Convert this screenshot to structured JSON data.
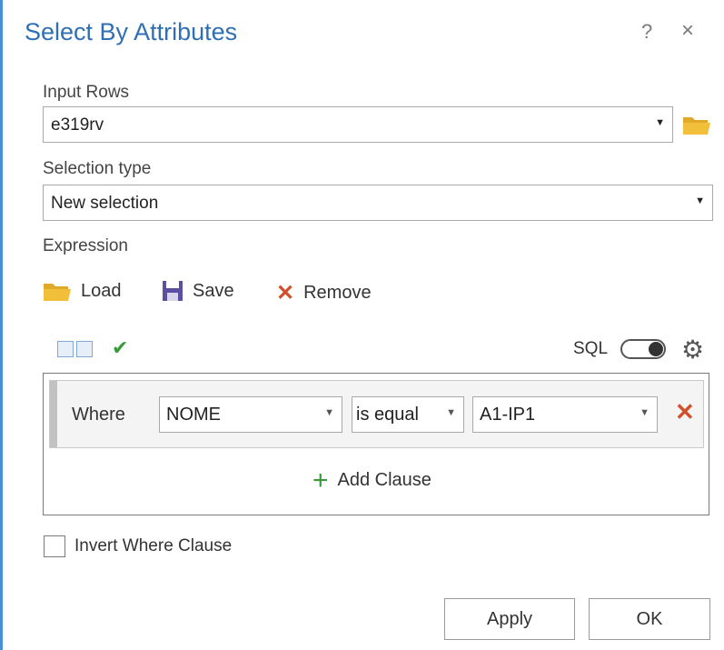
{
  "dialog": {
    "title": "Select By Attributes",
    "help_label": "?",
    "close_label": "×"
  },
  "input_rows": {
    "label": "Input Rows",
    "value": "e319rv"
  },
  "selection_type": {
    "label": "Selection type",
    "value": "New selection"
  },
  "expression": {
    "label": "Expression",
    "load_label": "Load",
    "save_label": "Save",
    "remove_label": "Remove",
    "sql_label": "SQL",
    "sql_toggle_on": false
  },
  "clause": {
    "where_label": "Where",
    "field": "NOME",
    "operator": "is equal",
    "value": "A1-IP1",
    "add_clause_label": "Add Clause"
  },
  "invert": {
    "label": "Invert Where Clause",
    "checked": false
  },
  "footer": {
    "apply_label": "Apply",
    "ok_label": "OK"
  },
  "colors": {
    "title": "#2f6fb3",
    "remove": "#d0502c",
    "add": "#3a9a3a",
    "folder": "#f2bf3b",
    "save": "#5a4fa0"
  }
}
